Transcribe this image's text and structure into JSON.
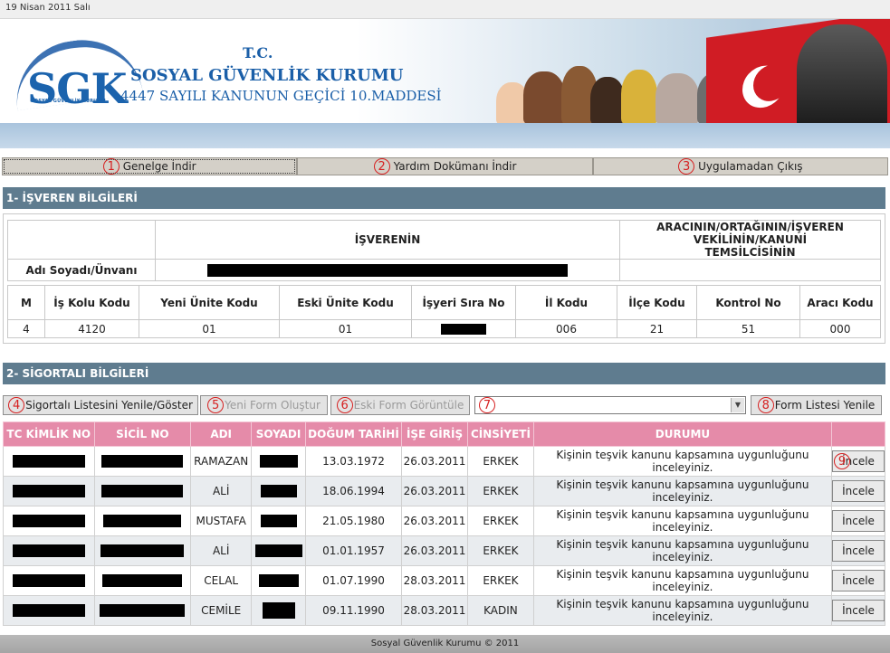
{
  "topbar": {
    "date": "19 Nisan 2011 Salı"
  },
  "banner": {
    "logo_text": "SGK",
    "logo_subtext": "SOSYAL GÜVENLİK KURUMU",
    "tc": "T.C.",
    "org_name": "SOSYAL GÜVENLİK KURUMU",
    "law": "4447 SAYILI KANUNUN GEÇİCİ 10.MADDESİ"
  },
  "nav": [
    {
      "num": "1",
      "label": "Genelge İndir"
    },
    {
      "num": "2",
      "label": "Yardım Dokümanı İndir"
    },
    {
      "num": "3",
      "label": "Uygulamadan Çıkış"
    }
  ],
  "section1": {
    "title": "1- İŞVEREN BİLGİLERİ",
    "isveren_header": "İŞVERENİN",
    "aracin_header": "ARACININ/ORTAĞININ/İŞVEREN VEKİLİNİN/KANUNİ TEMSİLCİSİNİN",
    "name_label": "Adı Soyadı/Ünvanı",
    "columns": [
      "M",
      "İş Kolu Kodu",
      "Yeni Ünite Kodu",
      "Eski Ünite Kodu",
      "İşyeri Sıra No",
      "İl Kodu",
      "İlçe Kodu",
      "Kontrol No",
      "Aracı Kodu"
    ],
    "values": [
      "4",
      "4120",
      "01",
      "01",
      "",
      "006",
      "21",
      "51",
      "000"
    ]
  },
  "section2": {
    "title": "2- SİGORTALI BİLGİLERİ",
    "btn_refresh_list": "Sigortalı Listesini Yenile/Göster",
    "btn_new_form": "Yeni Form Oluştur",
    "btn_view_form": "Eski Form Görüntüle",
    "btn_form_list": "Form Listesi Yenile",
    "markers": {
      "refresh": "4",
      "new": "5",
      "view": "6",
      "select": "7",
      "formlist": "8",
      "incele": "9"
    },
    "table_headers": [
      "TC KİMLİK NO",
      "SİCİL NO",
      "ADI",
      "SOYADI",
      "DOĞUM TARİHİ",
      "İŞE GİRİŞ",
      "CİNSİYETİ",
      "DURUMU",
      ""
    ],
    "rows": [
      {
        "adi": "RAMAZAN",
        "dogum": "13.03.1972",
        "ise_giris": "26.03.2011",
        "cinsiyet": "ERKEK",
        "durum": "Kişinin teşvik kanunu kapsamına uygunluğunu inceleyiniz.",
        "action": "İncele"
      },
      {
        "adi": "ALİ",
        "dogum": "18.06.1994",
        "ise_giris": "26.03.2011",
        "cinsiyet": "ERKEK",
        "durum": "Kişinin teşvik kanunu kapsamına uygunluğunu inceleyiniz.",
        "action": "İncele"
      },
      {
        "adi": "MUSTAFA",
        "dogum": "21.05.1980",
        "ise_giris": "26.03.2011",
        "cinsiyet": "ERKEK",
        "durum": "Kişinin teşvik kanunu kapsamına uygunluğunu inceleyiniz.",
        "action": "İncele"
      },
      {
        "adi": "ALİ",
        "dogum": "01.01.1957",
        "ise_giris": "26.03.2011",
        "cinsiyet": "ERKEK",
        "durum": "Kişinin teşvik kanunu kapsamına uygunluğunu inceleyiniz.",
        "action": "İncele"
      },
      {
        "adi": "CELAL",
        "dogum": "01.07.1990",
        "ise_giris": "28.03.2011",
        "cinsiyet": "ERKEK",
        "durum": "Kişinin teşvik kanunu kapsamına uygunluğunu inceleyiniz.",
        "action": "İncele"
      },
      {
        "adi": "CEMİLE",
        "dogum": "09.11.1990",
        "ise_giris": "28.03.2011",
        "cinsiyet": "KADIN",
        "durum": "Kişinin teşvik kanunu kapsamına uygunluğunu inceleyiniz.",
        "action": "İncele"
      }
    ]
  },
  "footer": {
    "text": "Sosyal Güvenlik Kurumu © 2011"
  },
  "colors": {
    "section_header": "#5f7c8f",
    "table_header": "#e58ba9",
    "marker": "#d62020",
    "sgk_blue": "#1b63ad"
  }
}
